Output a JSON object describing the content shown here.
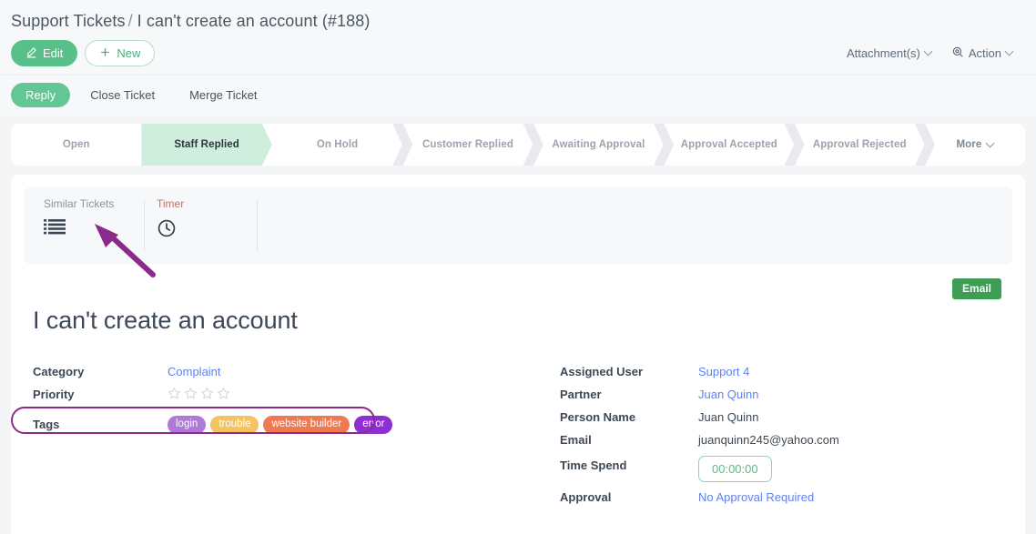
{
  "breadcrumb": {
    "root": "Support Tickets",
    "separator": "/",
    "current": "I can't create an account (#188)"
  },
  "header": {
    "edit_label": "Edit",
    "new_label": "New",
    "edit_icon": "pencil-icon",
    "new_icon": "plus-icon",
    "attachments_label": "Attachment(s)",
    "action_label": "Action",
    "action_icon": "target-icon"
  },
  "action_bar": {
    "items": [
      {
        "label": "Reply",
        "active": true
      },
      {
        "label": "Close Ticket",
        "active": false
      },
      {
        "label": "Merge Ticket",
        "active": false
      }
    ]
  },
  "pipeline": {
    "stages": [
      {
        "label": "Open",
        "current": false
      },
      {
        "label": "Staff Replied",
        "current": true
      },
      {
        "label": "On Hold",
        "current": false
      },
      {
        "label": "Customer Replied",
        "current": false
      },
      {
        "label": "Awaiting Approval",
        "current": false
      },
      {
        "label": "Approval Accepted",
        "current": false
      },
      {
        "label": "Approval Rejected",
        "current": false
      }
    ],
    "more_label": "More"
  },
  "tools": {
    "similar_tickets_label": "Similar Tickets",
    "similar_tickets_icon": "list-icon",
    "timer_label": "Timer",
    "timer_icon": "clock-icon"
  },
  "ticket": {
    "badge": "Email",
    "title": "I can't create an account"
  },
  "left_fields": {
    "category_label": "Category",
    "category_value": "Complaint",
    "priority_label": "Priority",
    "priority_stars_total": 4,
    "priority_stars_filled": 0,
    "tags_label": "Tags",
    "tags": [
      {
        "label": "login",
        "color": "#b078d8"
      },
      {
        "label": "trouble",
        "color": "#f5c462"
      },
      {
        "label": "website builder",
        "color": "#ef7a52"
      },
      {
        "label": "error",
        "color": "#8e2fd4"
      }
    ]
  },
  "right_fields": {
    "assigned_user_label": "Assigned User",
    "assigned_user_value": "Support 4",
    "partner_label": "Partner",
    "partner_value": "Juan Quinn",
    "person_name_label": "Person Name",
    "person_name_value": "Juan Quinn",
    "email_label": "Email",
    "email_value": "juanquinn245@yahoo.com",
    "time_spend_label": "Time Spend",
    "time_spend_value": "00:00:00",
    "approval_label": "Approval",
    "approval_value": "No Approval Required"
  },
  "annotations": {
    "arrow_color": "#8c2a8c",
    "oval_color": "#8c2a8c"
  },
  "colors": {
    "primary_green": "#59c08a",
    "badge_green": "#3d9d54",
    "current_stage": "#cfeede",
    "link_blue": "#5e81f4"
  }
}
